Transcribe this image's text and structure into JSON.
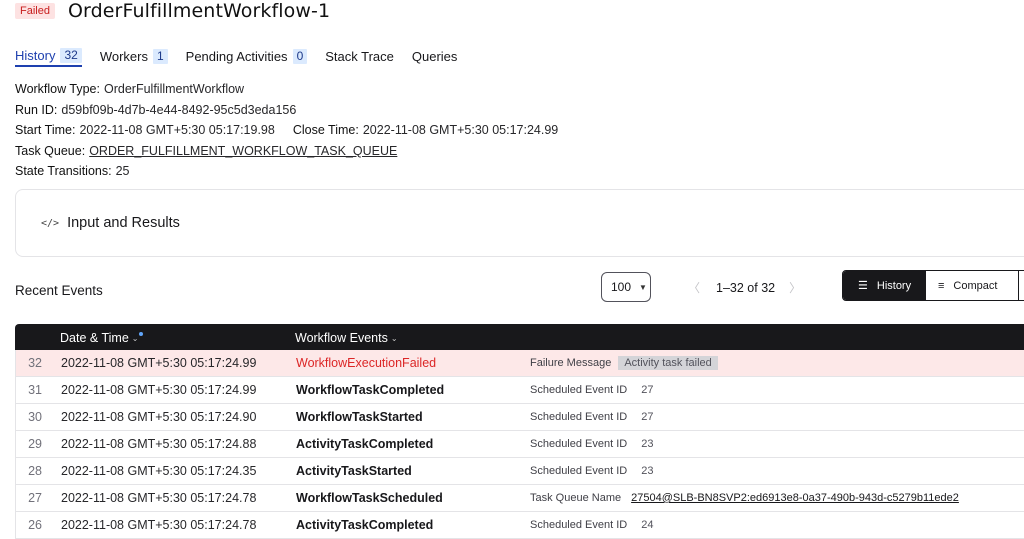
{
  "header": {
    "status": "Failed",
    "title": "OrderFulfillmentWorkflow-1"
  },
  "tabs": [
    {
      "label": "History",
      "count": "32",
      "active": true
    },
    {
      "label": "Workers",
      "count": "1"
    },
    {
      "label": "Pending Activities",
      "count": "0"
    },
    {
      "label": "Stack Trace"
    },
    {
      "label": "Queries"
    }
  ],
  "details": {
    "workflow_type_k": "Workflow Type:",
    "workflow_type_v": "OrderFulfillmentWorkflow",
    "run_id_k": "Run ID:",
    "run_id_v": "d59bf09b-4d7b-4e44-8492-95c5d3eda156",
    "start_time_k": "Start Time:",
    "start_time_v": "2022-11-08 GMT+5:30 05:17:19.98",
    "close_time_k": "Close Time:",
    "close_time_v": "2022-11-08 GMT+5:30 05:17:24.99",
    "task_queue_k": "Task Queue:",
    "task_queue_v": "ORDER_FULFILLMENT_WORKFLOW_TASK_QUEUE",
    "state_k": "State Transitions:",
    "state_v": "25"
  },
  "io": {
    "icon": "</>",
    "label": "Input and Results"
  },
  "recent": {
    "title": "Recent Events",
    "page_size": "100",
    "range": "1–32 of 32",
    "view_history": "History",
    "view_compact": "Compact"
  },
  "table": {
    "col_date": "Date & Time",
    "col_events": "Workflow Events",
    "rows": [
      {
        "id": "32",
        "date": "2022-11-08 GMT+5:30 05:17:24.99",
        "event": "WorkflowExecutionFailed",
        "dk": "Failure Message",
        "dv": "Activity task failed"
      },
      {
        "id": "31",
        "date": "2022-11-08 GMT+5:30 05:17:24.99",
        "event": "WorkflowTaskCompleted",
        "dk": "Scheduled Event ID",
        "dv": "27"
      },
      {
        "id": "30",
        "date": "2022-11-08 GMT+5:30 05:17:24.90",
        "event": "WorkflowTaskStarted",
        "dk": "Scheduled Event ID",
        "dv": "27"
      },
      {
        "id": "29",
        "date": "2022-11-08 GMT+5:30 05:17:24.88",
        "event": "ActivityTaskCompleted",
        "dk": "Scheduled Event ID",
        "dv": "23"
      },
      {
        "id": "28",
        "date": "2022-11-08 GMT+5:30 05:17:24.35",
        "event": "ActivityTaskStarted",
        "dk": "Scheduled Event ID",
        "dv": "23"
      },
      {
        "id": "27",
        "date": "2022-11-08 GMT+5:30 05:17:24.78",
        "event": "WorkflowTaskScheduled",
        "dk": "Task Queue Name",
        "dv": "27504@SLB-BN8SVP2:ed6913e8-0a37-490b-943d-c5279b11ede2"
      },
      {
        "id": "26",
        "date": "2022-11-08 GMT+5:30 05:17:24.78",
        "event": "ActivityTaskCompleted",
        "dk": "Scheduled Event ID",
        "dv": "24"
      }
    ]
  }
}
